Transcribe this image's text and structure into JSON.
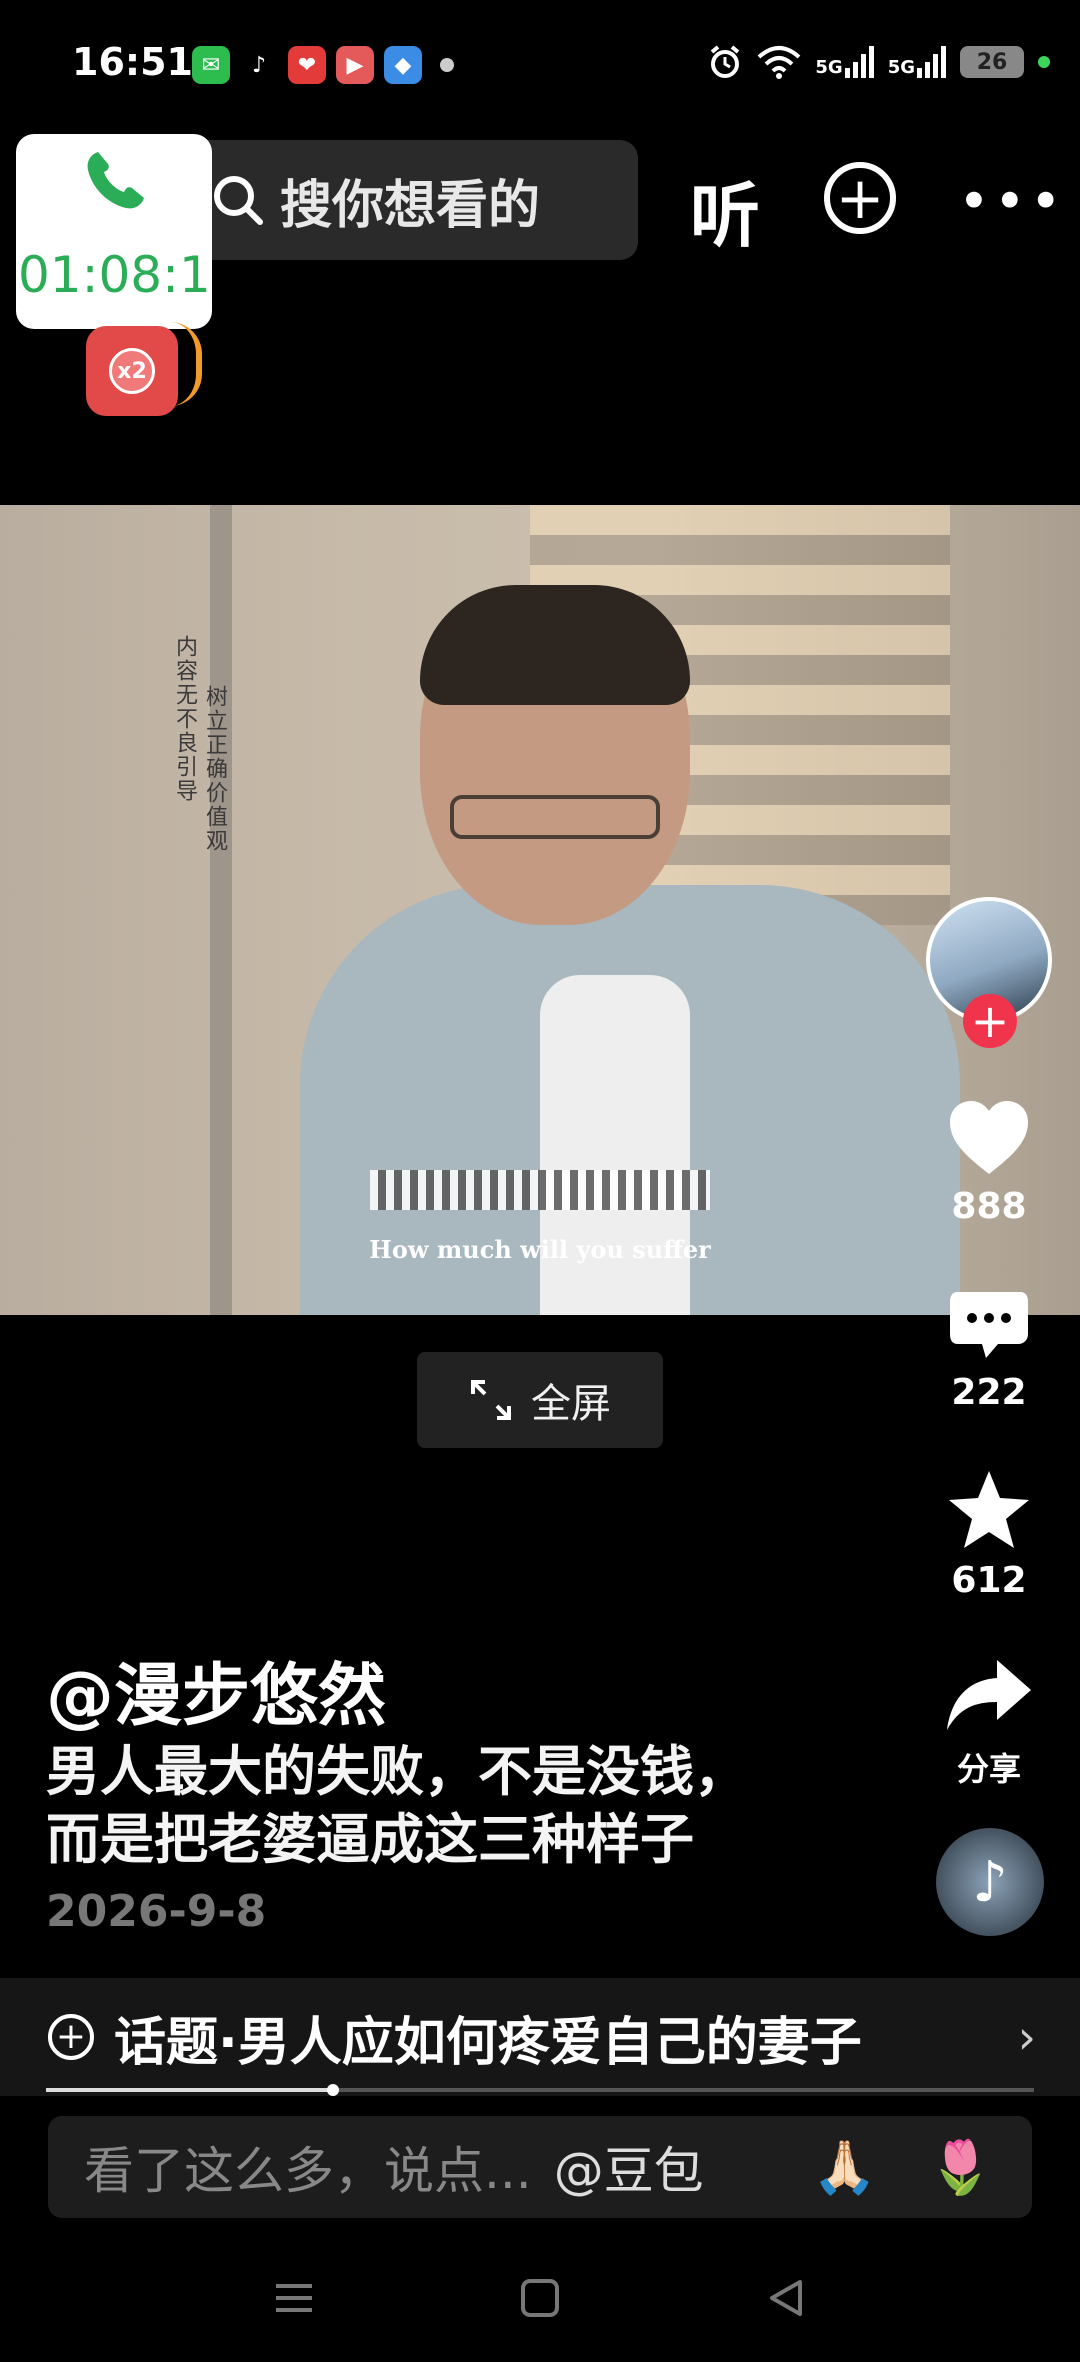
{
  "status_bar": {
    "time": "16:51",
    "notifications": [
      {
        "icon": "wechat-icon",
        "color": "#2dbd4f",
        "glyph": "✉"
      },
      {
        "icon": "tiktok-icon",
        "color": "#000000",
        "glyph": "♪"
      },
      {
        "icon": "heart-app-icon",
        "color": "#e33a3a",
        "glyph": "❤"
      },
      {
        "icon": "video-app-icon",
        "color": "#e45a5a",
        "glyph": "▶"
      },
      {
        "icon": "browser-app-icon",
        "color": "#3a8ce4",
        "glyph": "◆"
      }
    ],
    "network": "5G",
    "battery": "26"
  },
  "top_bar": {
    "search_placeholder": "搜你想看的",
    "listen_label": "听"
  },
  "call_overlay": {
    "timer": "01:08:1"
  },
  "red_packet": {
    "badge": "x2"
  },
  "video": {
    "overlay_left": "内容无不良引导",
    "overlay_right": "树立正确价值观",
    "subtitle": "How much will you suffer"
  },
  "fullscreen_label": "全屏",
  "actions": {
    "likes": "888",
    "comments": "222",
    "favorites": "612",
    "share_label": "分享"
  },
  "post": {
    "author": "@漫步悠然",
    "description_line1": "男人最大的失败，不是没钱，",
    "description_line2": "而是把老婆逼成这三种样子",
    "date": "2026-9-8"
  },
  "topic": {
    "label": "话题·男人应如何疼爱自己的妻子"
  },
  "progress": {
    "fraction": 0.29
  },
  "comment_bar": {
    "placeholder": "看了这么多，说点...",
    "mention": "@豆包",
    "emoji_1": "🙏🏻",
    "emoji_2": "🌷"
  }
}
